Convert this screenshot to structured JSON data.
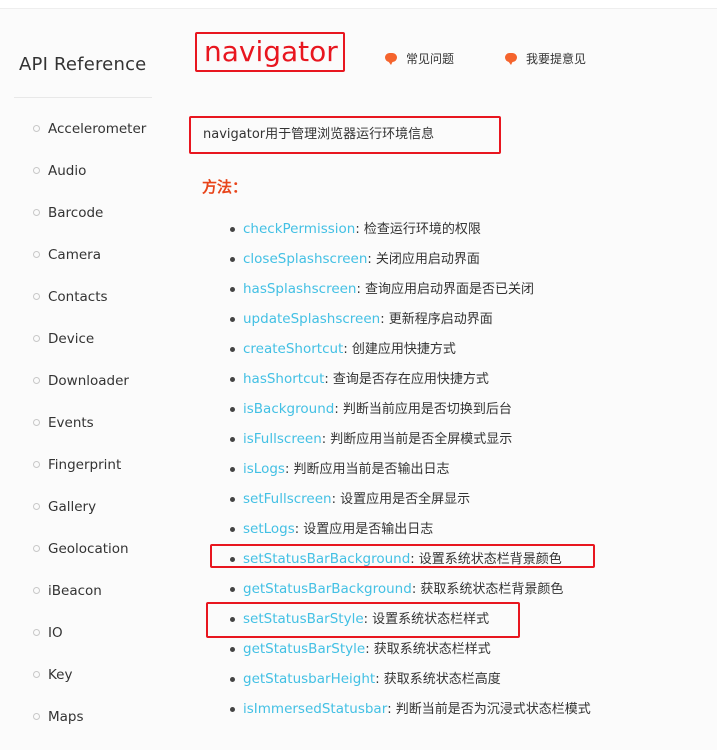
{
  "sidebar": {
    "title": "API Reference",
    "items": [
      "Accelerometer",
      "Audio",
      "Barcode",
      "Camera",
      "Contacts",
      "Device",
      "Downloader",
      "Events",
      "Fingerprint",
      "Gallery",
      "Geolocation",
      "iBeacon",
      "IO",
      "Key",
      "Maps"
    ]
  },
  "header": {
    "title": "navigator",
    "link_faq": "常见问题",
    "link_feedback": "我要提意见"
  },
  "main": {
    "description": "navigator用于管理浏览器运行环境信息",
    "methods_heading": "方法：",
    "methods": [
      {
        "name": "checkPermission",
        "desc": ": 检查运行环境的权限"
      },
      {
        "name": "closeSplashscreen",
        "desc": ": 关闭应用启动界面"
      },
      {
        "name": "hasSplashscreen",
        "desc": ": 查询应用启动界面是否已关闭"
      },
      {
        "name": "updateSplashscreen",
        "desc": ": 更新程序启动界面"
      },
      {
        "name": "createShortcut",
        "desc": ": 创建应用快捷方式"
      },
      {
        "name": "hasShortcut",
        "desc": ": 查询是否存在应用快捷方式"
      },
      {
        "name": "isBackground",
        "desc": ": 判断当前应用是否切换到后台"
      },
      {
        "name": "isFullscreen",
        "desc": ": 判断应用当前是否全屏模式显示"
      },
      {
        "name": "isLogs",
        "desc": ": 判断应用当前是否输出日志"
      },
      {
        "name": "setFullscreen",
        "desc": ": 设置应用是否全屏显示"
      },
      {
        "name": "setLogs",
        "desc": ": 设置应用是否输出日志"
      },
      {
        "name": "setStatusBarBackground",
        "desc": ": 设置系统状态栏背景颜色"
      },
      {
        "name": "getStatusBarBackground",
        "desc": ": 获取系统状态栏背景颜色"
      },
      {
        "name": "setStatusBarStyle",
        "desc": ": 设置系统状态栏样式"
      },
      {
        "name": "getStatusBarStyle",
        "desc": ": 获取系统状态栏样式"
      },
      {
        "name": "getStatusbarHeight",
        "desc": ": 获取系统状态栏高度"
      },
      {
        "name": "isImmersedStatusbar",
        "desc": ": 判断当前是否为沉浸式状态栏模式"
      }
    ]
  },
  "colors": {
    "accent_red": "#e8161f",
    "heading_orange": "#e8441a",
    "link_blue": "#43c0e4",
    "bubble_orange": "#f5642d"
  },
  "icons": {
    "header_link_icon": "speech-bubble-icon",
    "sidebar_bullet": "circle-bullet-icon",
    "method_bullet": "disc-bullet-icon"
  }
}
